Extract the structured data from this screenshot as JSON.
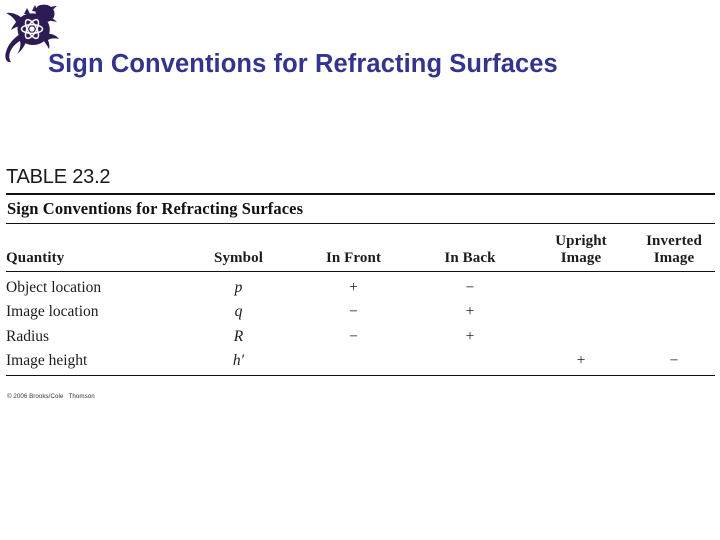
{
  "slide": {
    "background_color": "#ffffff",
    "logo": {
      "icon": "gecko-atom-logo",
      "body_color": "#2d1b55",
      "atom_color": "#ffffff"
    },
    "title": "Sign Conventions for Refracting Surfaces",
    "title_color": "#33348e"
  },
  "table": {
    "number_label": "TABLE 23.2",
    "caption": "Sign Conventions for Refracting Surfaces",
    "credit": "© 2006 Brooks/Cole   Thomson",
    "rule_color": "#111111",
    "headers": {
      "quantity": "Quantity",
      "symbol": "Symbol",
      "in_front": "In Front",
      "in_back": "In Back",
      "upright_image_line1": "Upright",
      "upright_image_line2": "Image",
      "inverted_image_line1": "Inverted",
      "inverted_image_line2": "Image"
    },
    "rows": [
      {
        "quantity": "Object location",
        "symbol": "p",
        "in_front": "+",
        "in_back": "−",
        "upright_image": "",
        "inverted_image": ""
      },
      {
        "quantity": "Image location",
        "symbol": "q",
        "in_front": "−",
        "in_back": "+",
        "upright_image": "",
        "inverted_image": ""
      },
      {
        "quantity": "Radius",
        "symbol": "R",
        "in_front": "−",
        "in_back": "+",
        "upright_image": "",
        "inverted_image": ""
      },
      {
        "quantity": "Image height",
        "symbol": "h′",
        "in_front": "",
        "in_back": "",
        "upright_image": "+",
        "inverted_image": "−"
      }
    ]
  }
}
